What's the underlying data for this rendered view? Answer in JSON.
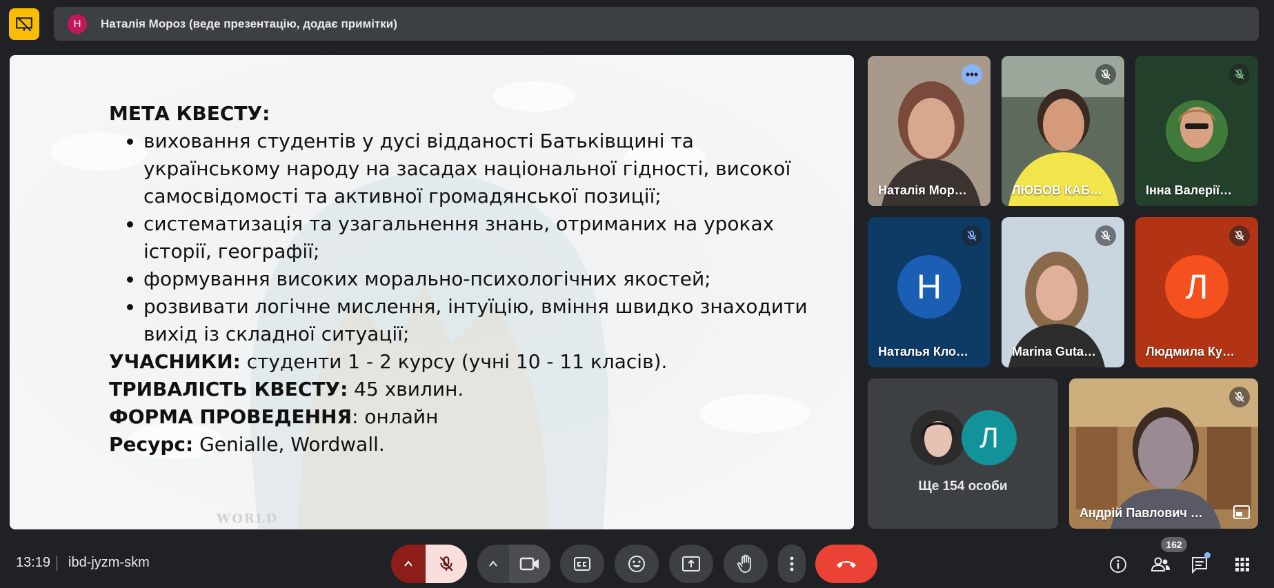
{
  "banner": {
    "avatar_letter": "Н",
    "text": "Наталія Мороз (веде презентацію, додає примітки)"
  },
  "slide": {
    "goal_heading": "МЕТА КВЕСТУ:",
    "goal_items": [
      "виховання студентів у дусі відданості Батьківщині та українському народу на засадах національної гідності, високої самосвідомості та активної громадянської позиції;",
      "систематизація та узагальнення знань, отриманих на уроках історії, географії;",
      "формування високих морально-психологічних якостей;",
      "розвивати логічне мислення, інтуїцію, вміння швидко знаходити вихід із складної ситуації;"
    ],
    "participants_label": "УЧАСНИКИ:",
    "participants_value": " студенти 1 - 2 курсу (учні 10 - 11 класів).",
    "duration_label": "ТРИВАЛІСТЬ КВЕСТУ:",
    "duration_value": " 45 хвилин.",
    "format_label": "ФОРМА ПРОВЕДЕННЯ",
    "format_value": ": онлайн",
    "resource_label": "Ресурс:",
    "resource_value": " Genialle, Wordwall.",
    "bg_label": "WORLD"
  },
  "participants": [
    {
      "name": "Наталія Мор…",
      "type": "video",
      "speaking": true
    },
    {
      "name": "ЛЮБОВ КАБ…",
      "type": "video",
      "muted": true
    },
    {
      "name": "Інна Валерії…",
      "type": "photo",
      "muted": true
    },
    {
      "name": "Наталья Кло…",
      "type": "letter",
      "letter": "Н",
      "color": "#1a5fb4",
      "muted": true
    },
    {
      "name": "Marina Guta…",
      "type": "video",
      "muted": true
    },
    {
      "name": "Людмила Ку…",
      "type": "letter",
      "letter": "Л",
      "color": "#f4511e",
      "muted": true
    },
    {
      "name": "Андрій Павлович …",
      "type": "video",
      "muted": true
    }
  ],
  "others": {
    "avatar_letter": "Л",
    "label": "Ще 154 особи"
  },
  "bottom": {
    "time": "13:19",
    "meeting_code": "ibd-jyzm-skm",
    "participant_count": "162"
  },
  "colors": {
    "background": "#202124",
    "tile": "#3c4043",
    "end_call": "#ea4335",
    "mic_off_active": "#f9dedc",
    "present_banner": "#fbbc04"
  }
}
